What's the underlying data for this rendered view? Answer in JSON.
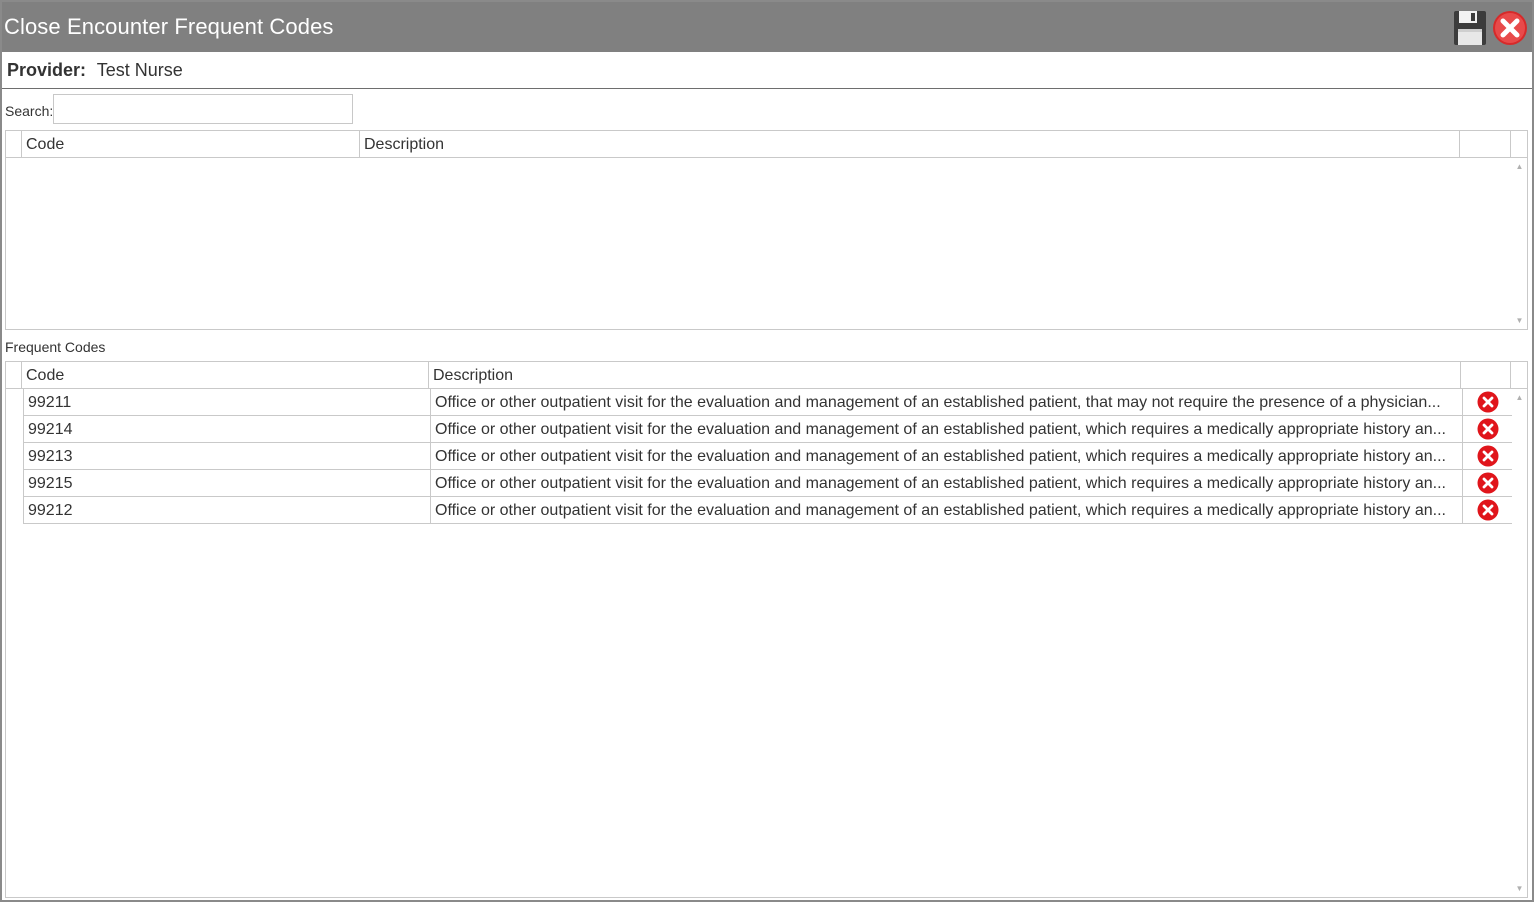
{
  "window": {
    "title": "Close Encounter Frequent Codes",
    "save_icon": "save-disk-icon",
    "close_icon": "close-circle-icon"
  },
  "provider": {
    "label": "Provider:",
    "value": "Test Nurse"
  },
  "search": {
    "label": "Search:",
    "value": "",
    "placeholder": ""
  },
  "search_results": {
    "columns": [
      "Code",
      "Description"
    ],
    "rows": []
  },
  "frequent_codes": {
    "label": "Frequent Codes",
    "columns": [
      "Code",
      "Description"
    ],
    "rows": [
      {
        "code": "99211",
        "description": "Office or other outpatient visit for the evaluation and management of an established patient, that may not require the presence of a physician..."
      },
      {
        "code": "99214",
        "description": "Office or other outpatient visit for the evaluation and management of an established patient, which requires a medically appropriate history an..."
      },
      {
        "code": "99213",
        "description": "Office or other outpatient visit for the evaluation and management of an established patient, which requires a medically appropriate history an..."
      },
      {
        "code": "99215",
        "description": "Office or other outpatient visit for the evaluation and management of an established patient, which requires a medically appropriate history an..."
      },
      {
        "code": "99212",
        "description": "Office or other outpatient visit for the evaluation and management of an established patient, which requires a medically appropriate history an..."
      }
    ],
    "row_action_icon": "delete-x-icon"
  },
  "colors": {
    "titlebar": "#808080",
    "delete": "#e0151b",
    "grid_border": "#c9c9c9"
  }
}
